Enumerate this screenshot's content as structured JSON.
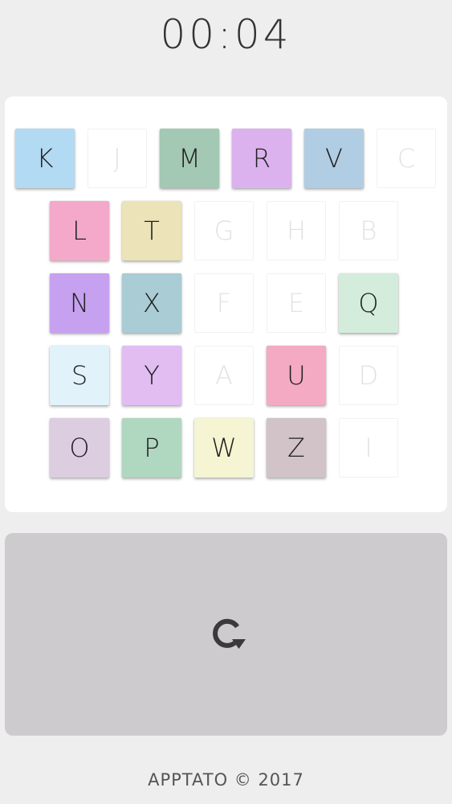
{
  "timer": "00:04",
  "board": {
    "rows": [
      [
        {
          "letter": "K",
          "color": "#b3daf3",
          "used": false
        },
        {
          "letter": "J",
          "color": "#ffffff",
          "used": true
        },
        {
          "letter": "M",
          "color": "#a3c8b4",
          "used": false
        },
        {
          "letter": "R",
          "color": "#dcb2ee",
          "used": false
        },
        {
          "letter": "V",
          "color": "#b1cde3",
          "used": false
        },
        {
          "letter": "C",
          "color": "#ffffff",
          "used": true
        }
      ],
      [
        {
          "letter": "L",
          "color": "#f4a9cb",
          "used": false
        },
        {
          "letter": "T",
          "color": "#ece3b8",
          "used": false
        },
        {
          "letter": "G",
          "color": "#ffffff",
          "used": true
        },
        {
          "letter": "H",
          "color": "#ffffff",
          "used": true
        },
        {
          "letter": "B",
          "color": "#ffffff",
          "used": true
        }
      ],
      [
        {
          "letter": "N",
          "color": "#c6a1f0",
          "used": false
        },
        {
          "letter": "X",
          "color": "#a9ccd5",
          "used": false
        },
        {
          "letter": "F",
          "color": "#ffffff",
          "used": true
        },
        {
          "letter": "E",
          "color": "#ffffff",
          "used": true
        },
        {
          "letter": "Q",
          "color": "#d4ecdb",
          "used": false
        }
      ],
      [
        {
          "letter": "S",
          "color": "#e2f2fb",
          "used": false
        },
        {
          "letter": "Y",
          "color": "#e1bdf2",
          "used": false
        },
        {
          "letter": "A",
          "color": "#ffffff",
          "used": true
        },
        {
          "letter": "U",
          "color": "#f4aac3",
          "used": false
        },
        {
          "letter": "D",
          "color": "#ffffff",
          "used": true
        }
      ],
      [
        {
          "letter": "O",
          "color": "#ddcde0",
          "used": false
        },
        {
          "letter": "P",
          "color": "#b0d7bf",
          "used": false
        },
        {
          "letter": "W",
          "color": "#f5f5d3",
          "used": false
        },
        {
          "letter": "Z",
          "color": "#d1c3c7",
          "used": false
        },
        {
          "letter": "I",
          "color": "#ffffff",
          "used": true
        }
      ]
    ]
  },
  "reset": {
    "icon": "restart-icon"
  },
  "footer": "APPTATO © 2017"
}
